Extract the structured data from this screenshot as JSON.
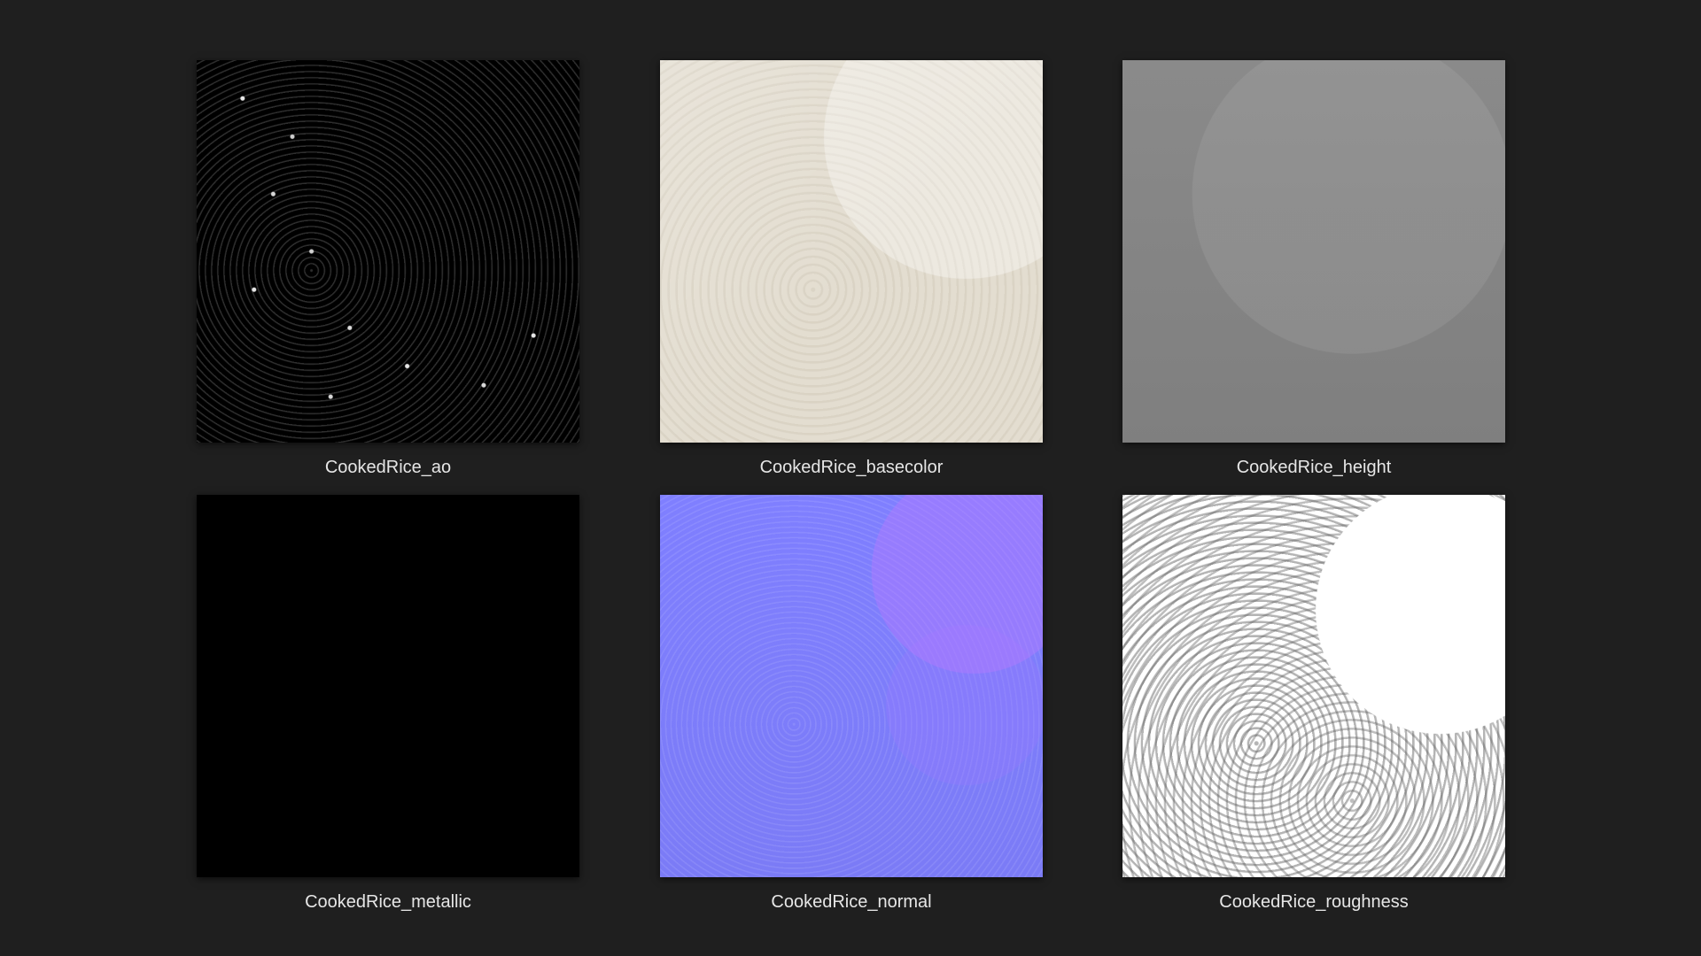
{
  "textures": [
    {
      "label": "CookedRice_ao"
    },
    {
      "label": "CookedRice_basecolor"
    },
    {
      "label": "CookedRice_height"
    },
    {
      "label": "CookedRice_metallic"
    },
    {
      "label": "CookedRice_normal"
    },
    {
      "label": "CookedRice_roughness"
    }
  ]
}
